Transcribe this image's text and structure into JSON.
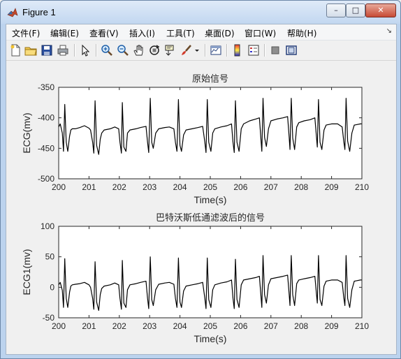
{
  "window": {
    "title": "Figure 1",
    "controls": {
      "minimize": "–",
      "maximize": "□",
      "close": "✕"
    }
  },
  "menu": {
    "items": [
      {
        "label": "文件(F)"
      },
      {
        "label": "编辑(E)"
      },
      {
        "label": "查看(V)"
      },
      {
        "label": "插入(I)"
      },
      {
        "label": "工具(T)"
      },
      {
        "label": "桌面(D)"
      },
      {
        "label": "窗口(W)"
      },
      {
        "label": "帮助(H)"
      }
    ],
    "overflow_icon": "chevron-down-icon"
  },
  "toolbar": {
    "buttons": [
      {
        "icon": "new-figure-icon"
      },
      {
        "icon": "open-file-icon"
      },
      {
        "icon": "save-icon"
      },
      {
        "icon": "print-icon"
      },
      {
        "icon": "arrow-select-icon"
      },
      {
        "icon": "zoom-in-icon"
      },
      {
        "icon": "zoom-out-icon"
      },
      {
        "icon": "pan-hand-icon"
      },
      {
        "icon": "rotate-3d-icon"
      },
      {
        "icon": "data-cursor-icon"
      },
      {
        "icon": "brush-icon"
      },
      {
        "icon": "link-plot-icon"
      },
      {
        "icon": "colorbar-icon"
      },
      {
        "icon": "legend-icon"
      },
      {
        "icon": "hide-plot-tools-icon"
      },
      {
        "icon": "show-plot-tools-icon"
      }
    ]
  },
  "chart_data": [
    {
      "type": "line",
      "title": "原始信号",
      "xlabel": "Time(s)",
      "ylabel": "ECG(mv)",
      "xlim": [
        200,
        210
      ],
      "ylim": [
        -500,
        -350
      ],
      "xticks": [
        200,
        201,
        202,
        203,
        204,
        205,
        206,
        207,
        208,
        209,
        210
      ],
      "yticks": [
        -350,
        -400,
        -450,
        -500
      ],
      "grid": false,
      "color": "#000000",
      "series": [
        {
          "x": [
            200.0,
            200.05,
            200.12,
            200.16,
            200.2,
            200.25,
            200.3,
            200.36,
            200.4,
            200.45,
            200.55,
            200.7,
            200.85,
            201.0,
            201.05,
            201.12,
            201.16,
            201.2,
            201.25,
            201.32,
            201.37,
            201.42,
            201.5,
            201.7,
            201.85,
            201.98,
            202.02,
            202.07,
            202.1,
            202.15,
            202.22,
            202.27,
            202.35,
            202.55,
            202.7,
            202.88,
            202.93,
            202.97,
            203.02,
            203.07,
            203.12,
            203.2,
            203.3,
            203.5,
            203.65,
            203.8,
            203.85,
            203.9,
            203.95,
            204.0,
            204.05,
            204.12,
            204.2,
            204.4,
            204.6,
            204.75,
            204.82,
            204.86,
            204.9,
            204.95,
            205.02,
            205.08,
            205.15,
            205.35,
            205.55,
            205.7,
            205.75,
            205.79,
            205.83,
            205.88,
            205.95,
            206.02,
            206.1,
            206.3,
            206.5,
            206.62,
            206.67,
            206.7,
            206.74,
            206.79,
            206.85,
            206.92,
            207.0,
            207.2,
            207.4,
            207.55,
            207.6,
            207.63,
            207.67,
            207.72,
            207.78,
            207.85,
            207.92,
            208.1,
            208.3,
            208.45,
            208.5,
            208.53,
            208.57,
            208.62,
            208.68,
            208.75,
            208.82,
            209.0,
            209.2,
            209.35,
            209.4,
            209.44,
            209.48,
            209.53,
            209.6,
            209.67,
            209.75,
            209.95,
            210.0
          ],
          "y": [
            -415,
            -410,
            -425,
            -455,
            -378,
            -440,
            -455,
            -430,
            -420,
            -418,
            -418,
            -416,
            -413,
            -417,
            -420,
            -440,
            -458,
            -372,
            -445,
            -460,
            -435,
            -425,
            -420,
            -418,
            -415,
            -418,
            -440,
            -458,
            -375,
            -448,
            -455,
            -425,
            -420,
            -418,
            -416,
            -414,
            -440,
            -457,
            -368,
            -440,
            -450,
            -425,
            -418,
            -416,
            -415,
            -418,
            -440,
            -455,
            -370,
            -445,
            -455,
            -428,
            -420,
            -418,
            -416,
            -414,
            -440,
            -457,
            -370,
            -440,
            -455,
            -425,
            -418,
            -415,
            -413,
            -410,
            -440,
            -457,
            -372,
            -440,
            -455,
            -418,
            -410,
            -405,
            -402,
            -400,
            -435,
            -455,
            -368,
            -432,
            -447,
            -418,
            -405,
            -402,
            -400,
            -398,
            -430,
            -452,
            -368,
            -433,
            -452,
            -415,
            -408,
            -405,
            -403,
            -400,
            -430,
            -448,
            -370,
            -440,
            -452,
            -420,
            -412,
            -410,
            -410,
            -415,
            -438,
            -452,
            -368,
            -438,
            -455,
            -425,
            -412,
            -410,
            -410
          ]
        }
      ]
    },
    {
      "type": "line",
      "title": "巴特沃斯低通滤波后的信号",
      "xlabel": "Time(s)",
      "ylabel": "ECG1(mv)",
      "xlim": [
        200,
        210
      ],
      "ylim": [
        -50,
        100
      ],
      "xticks": [
        200,
        201,
        202,
        203,
        204,
        205,
        206,
        207,
        208,
        209,
        210
      ],
      "yticks": [
        100,
        50,
        0,
        -50
      ],
      "grid": false,
      "color": "#000000",
      "series": [
        {
          "x": [
            200.0,
            200.05,
            200.12,
            200.16,
            200.2,
            200.25,
            200.3,
            200.36,
            200.4,
            200.45,
            200.55,
            200.7,
            200.85,
            201.0,
            201.05,
            201.12,
            201.16,
            201.2,
            201.25,
            201.32,
            201.37,
            201.42,
            201.5,
            201.7,
            201.85,
            201.98,
            202.02,
            202.07,
            202.1,
            202.15,
            202.22,
            202.27,
            202.35,
            202.55,
            202.7,
            202.88,
            202.93,
            202.97,
            203.02,
            203.07,
            203.12,
            203.2,
            203.3,
            203.5,
            203.65,
            203.8,
            203.85,
            203.9,
            203.95,
            204.0,
            204.05,
            204.12,
            204.2,
            204.4,
            204.6,
            204.75,
            204.82,
            204.86,
            204.9,
            204.95,
            205.02,
            205.08,
            205.15,
            205.35,
            205.55,
            205.7,
            205.75,
            205.79,
            205.83,
            205.88,
            205.95,
            206.02,
            206.1,
            206.3,
            206.5,
            206.62,
            206.67,
            206.7,
            206.74,
            206.79,
            206.85,
            206.92,
            207.0,
            207.2,
            207.4,
            207.55,
            207.6,
            207.63,
            207.67,
            207.72,
            207.78,
            207.85,
            207.92,
            208.1,
            208.3,
            208.45,
            208.5,
            208.53,
            208.57,
            208.62,
            208.68,
            208.75,
            208.82,
            209.0,
            209.2,
            209.35,
            209.4,
            209.44,
            209.48,
            209.53,
            209.6,
            209.67,
            209.75,
            209.95,
            210.0
          ],
          "y": [
            4,
            8,
            -5,
            -33,
            47,
            -18,
            -33,
            -8,
            2,
            4,
            5,
            6,
            8,
            4,
            0,
            -18,
            -36,
            42,
            -24,
            -38,
            -12,
            -2,
            2,
            4,
            7,
            4,
            -18,
            -36,
            44,
            -26,
            -33,
            -4,
            4,
            6,
            8,
            10,
            -18,
            -35,
            50,
            -20,
            -30,
            -4,
            5,
            7,
            8,
            5,
            -18,
            -33,
            48,
            -24,
            -33,
            -6,
            2,
            4,
            6,
            8,
            -18,
            -35,
            48,
            -20,
            -33,
            -4,
            4,
            7,
            9,
            12,
            -18,
            -35,
            46,
            -20,
            -33,
            4,
            12,
            14,
            16,
            18,
            -14,
            -33,
            52,
            -12,
            -26,
            4,
            14,
            16,
            18,
            20,
            -10,
            -30,
            52,
            -12,
            -30,
            6,
            12,
            14,
            16,
            18,
            -10,
            -26,
            52,
            -20,
            -30,
            2,
            10,
            12,
            12,
            8,
            -16,
            -30,
            52,
            -18,
            -33,
            -4,
            10,
            12,
            12
          ]
        }
      ]
    }
  ]
}
